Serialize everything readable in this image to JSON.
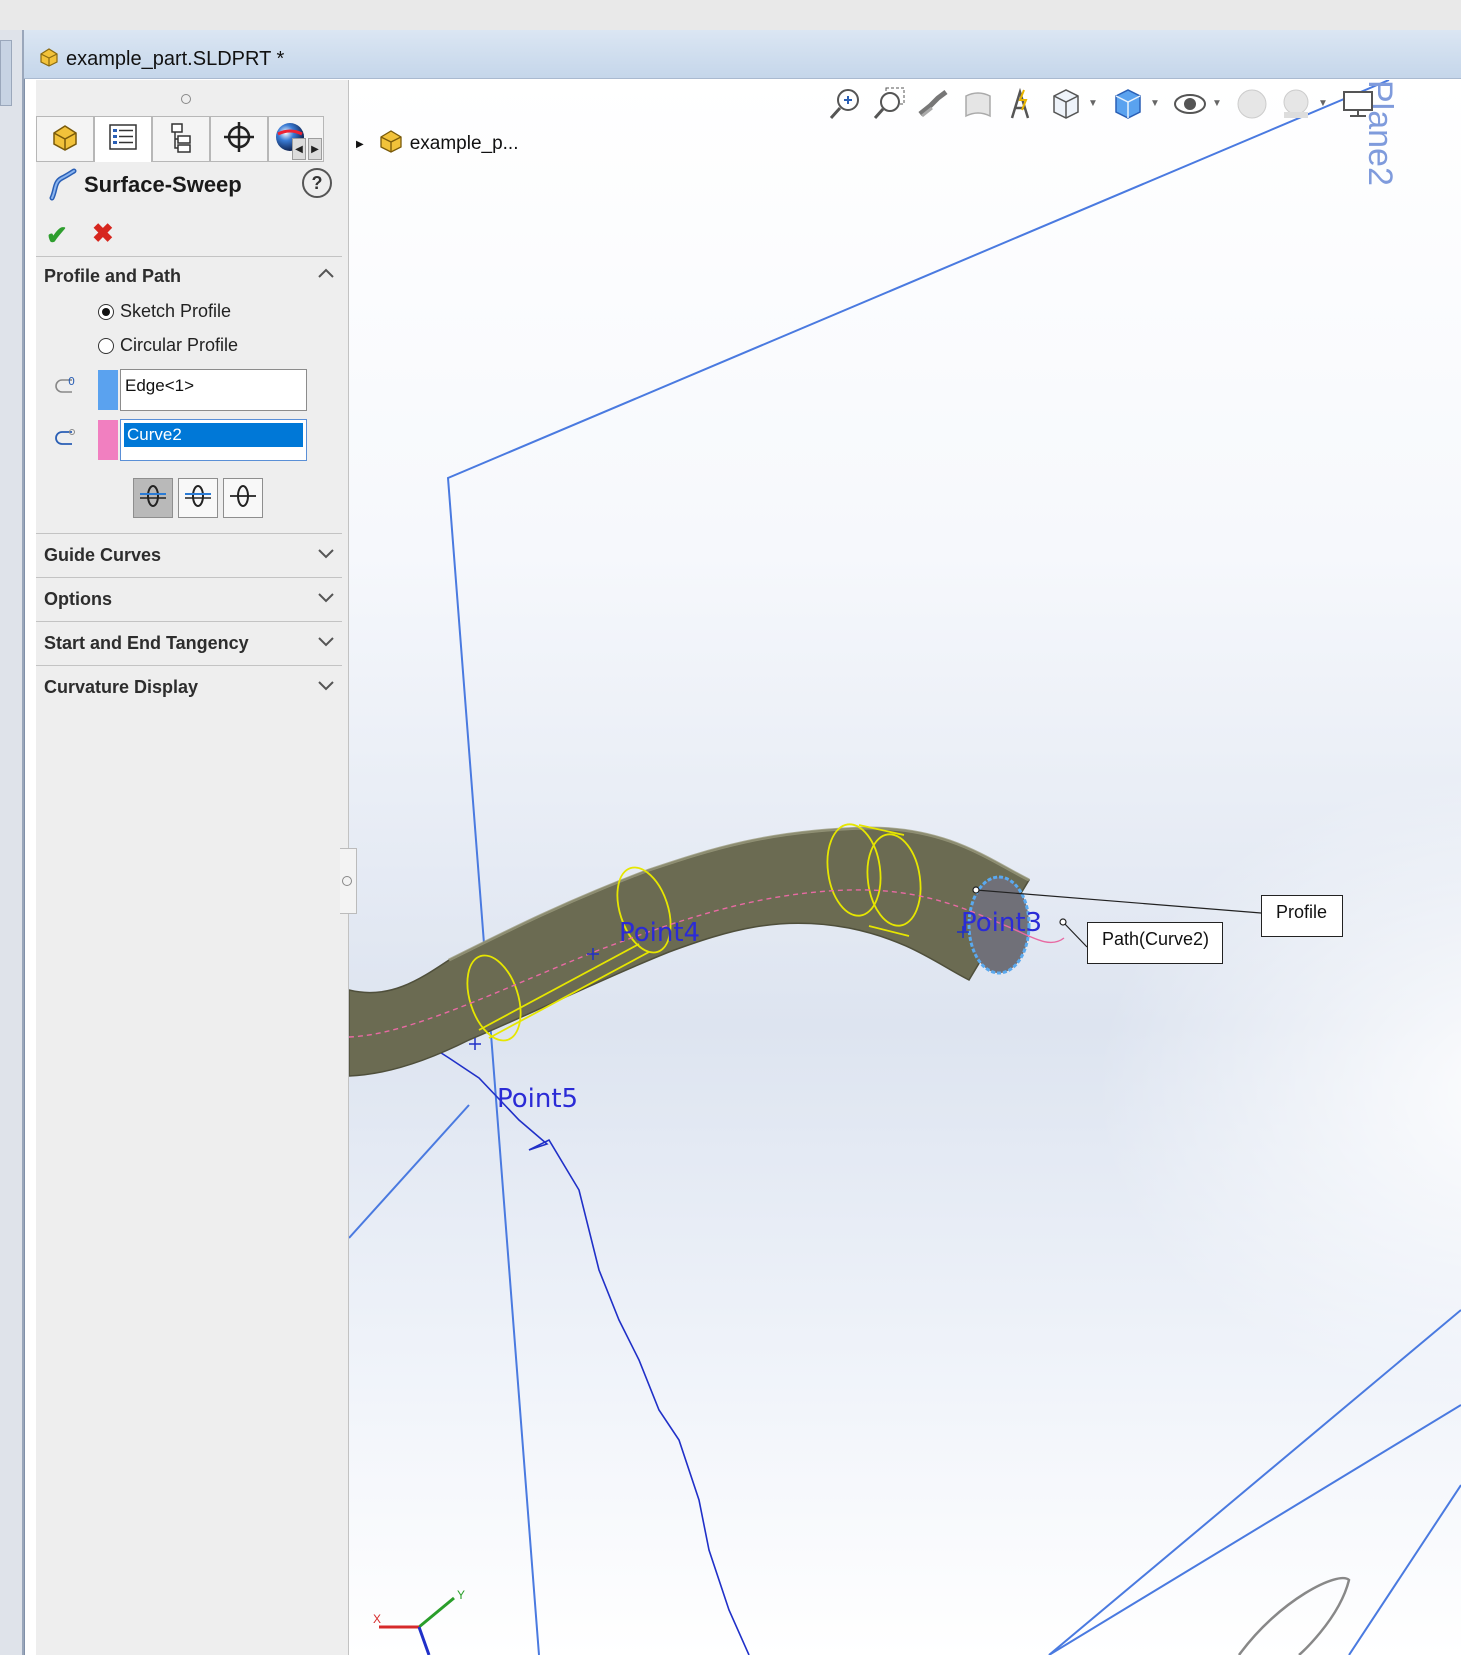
{
  "window": {
    "title": "example_part.SLDPRT *"
  },
  "breadcrumb": {
    "label": "example_p..."
  },
  "property_manager": {
    "feature_name": "Surface-Sweep",
    "help_symbol": "?",
    "ok_symbol": "✔",
    "cancel_symbol": "✖",
    "tabs": [
      {
        "name": "featuremanager-tab",
        "icon": "part-icon"
      },
      {
        "name": "propertymanager-tab",
        "icon": "property-list-icon"
      },
      {
        "name": "configuration-tab",
        "icon": "configuration-icon"
      },
      {
        "name": "dimxpert-tab",
        "icon": "crosshair-icon"
      },
      {
        "name": "appearance-tab",
        "icon": "appearance-sphere-icon"
      }
    ],
    "groups": {
      "profile_and_path": {
        "title": "Profile and Path",
        "expanded": true,
        "radio_sketch_profile": "Sketch Profile",
        "radio_circular_profile": "Circular Profile",
        "selected_radio": "Sketch Profile",
        "profile_selection": "Edge<1>",
        "profile_color": "#5aa2ef",
        "path_selection": "Curve2",
        "path_color": "#f17fc0",
        "selection_highlight": "#0078d7"
      },
      "guide_curves": {
        "title": "Guide Curves",
        "expanded": false
      },
      "options": {
        "title": "Options",
        "expanded": false
      },
      "start_end_tangency": {
        "title": "Start and End Tangency",
        "expanded": false
      },
      "curvature_display": {
        "title": "Curvature Display",
        "expanded": false
      }
    }
  },
  "viewport": {
    "labels": {
      "point3": "Point3",
      "point4": "Point4",
      "point5": "Point5",
      "plane": "Plane2"
    },
    "callouts": {
      "profile": "Profile",
      "path": "Path(Curve2)"
    },
    "triad": {
      "x": "X",
      "y": "Y"
    },
    "colors": {
      "sweep_surface": "#6b6b52",
      "plane_edge": "#4a7ae0",
      "sketch_curve": "#2030c8",
      "yellow_section": "#e6e600",
      "path_dashed": "#e86aa3",
      "point_label": "#2b2bd6"
    },
    "hud_icons": [
      "zoom-to-fit-icon",
      "zoom-to-area-icon",
      "previous-view-icon",
      "section-view-icon",
      "dynamic-annotation-view-icon",
      "view-orientation-icon",
      "display-style-icon",
      "hide-show-items-icon",
      "edit-appearance-icon",
      "apply-scene-icon",
      "view-settings-icon"
    ]
  }
}
